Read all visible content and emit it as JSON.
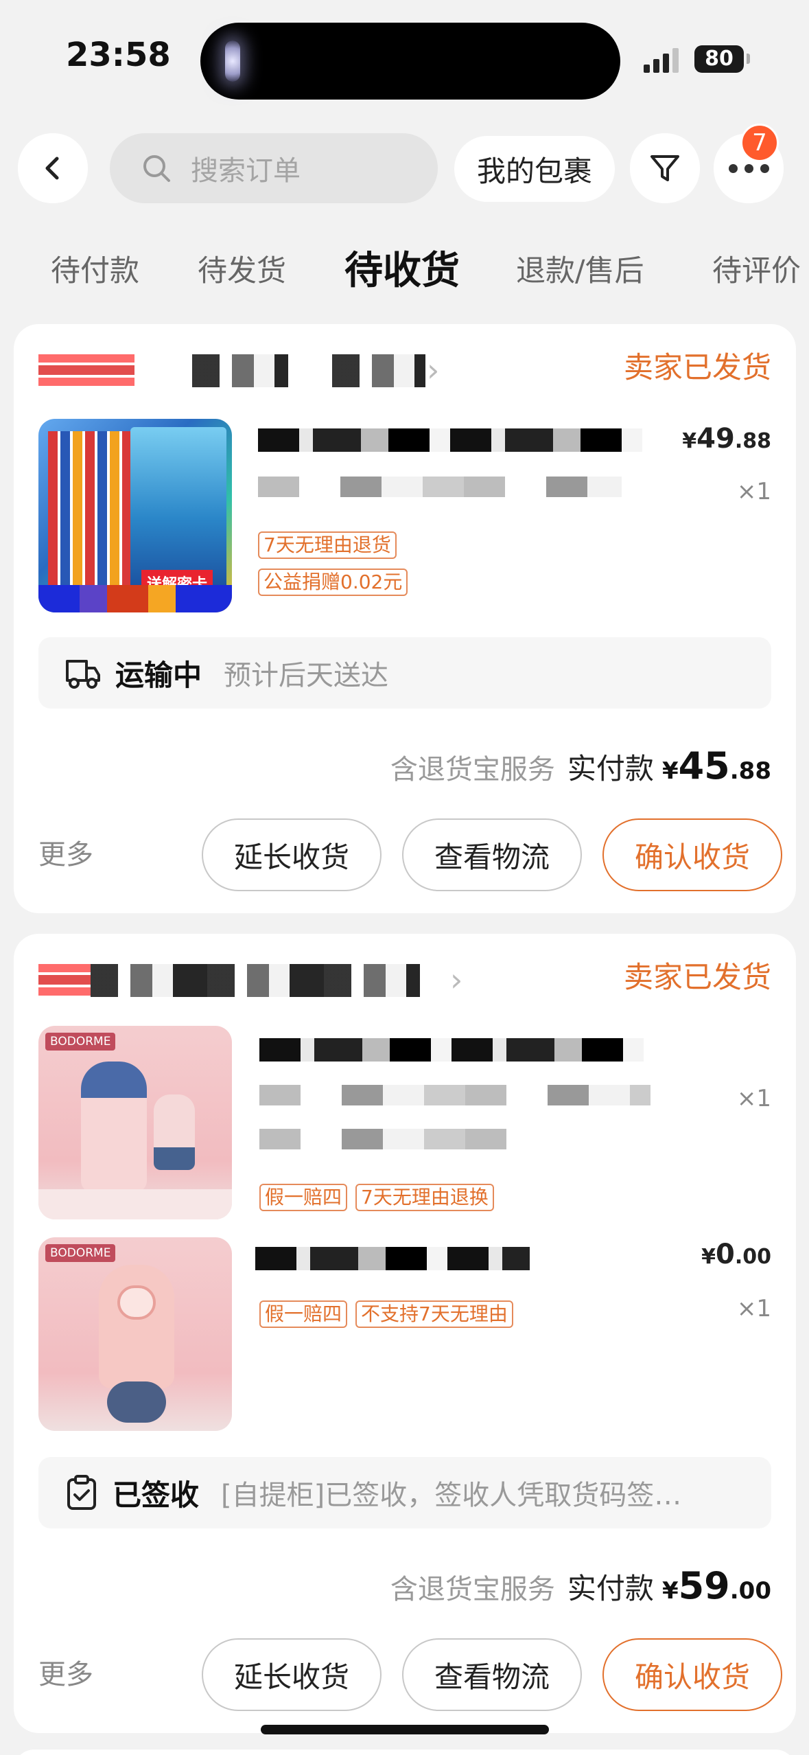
{
  "status_bar": {
    "time": "23:58",
    "battery": "80"
  },
  "header": {
    "search_placeholder": "搜索订单",
    "my_parcels": "我的包裹",
    "notification_count": "7"
  },
  "tabs": [
    {
      "label": "待付款"
    },
    {
      "label": "待发货"
    },
    {
      "label": "待收货",
      "active": true
    },
    {
      "label": "退款/售后"
    },
    {
      "label": "待评价"
    }
  ],
  "orders": [
    {
      "status": "卖家已发货",
      "items": [
        {
          "price_yen": "¥",
          "price_int": "49",
          "price_dec": ".88",
          "qty": "×1",
          "tags": [
            "7天无理由退货",
            "公益捐赠0.02元"
          ],
          "thumb_text": "送解密卡"
        }
      ],
      "logistics": {
        "status": "运输中",
        "detail": "预计后天送达"
      },
      "payment": {
        "service": "含退货宝服务",
        "label": "实付款",
        "yen": "¥",
        "int": "45",
        "dec": ".88"
      },
      "actions": {
        "more": "更多",
        "extend": "延长收货",
        "track": "查看物流",
        "confirm": "确认收货"
      }
    },
    {
      "status": "卖家已发货",
      "items": [
        {
          "qty": "×1",
          "tags": [
            "假一赔四",
            "7天无理由退换"
          ],
          "thumb_brand": "BODORME"
        },
        {
          "price_yen": "¥",
          "price_int": "0",
          "price_dec": ".00",
          "qty": "×1",
          "tags": [
            "假一赔四",
            "不支持7天无理由"
          ],
          "thumb_brand": "BODORME"
        }
      ],
      "logistics": {
        "status": "已签收",
        "detail": "[自提柜]已签收，签收人凭取货码签…"
      },
      "payment": {
        "service": "含退货宝服务",
        "label": "实付款",
        "yen": "¥",
        "int": "59",
        "dec": ".00"
      },
      "actions": {
        "more": "更多",
        "extend": "延长收货",
        "track": "查看物流",
        "confirm": "确认收货"
      }
    }
  ]
}
